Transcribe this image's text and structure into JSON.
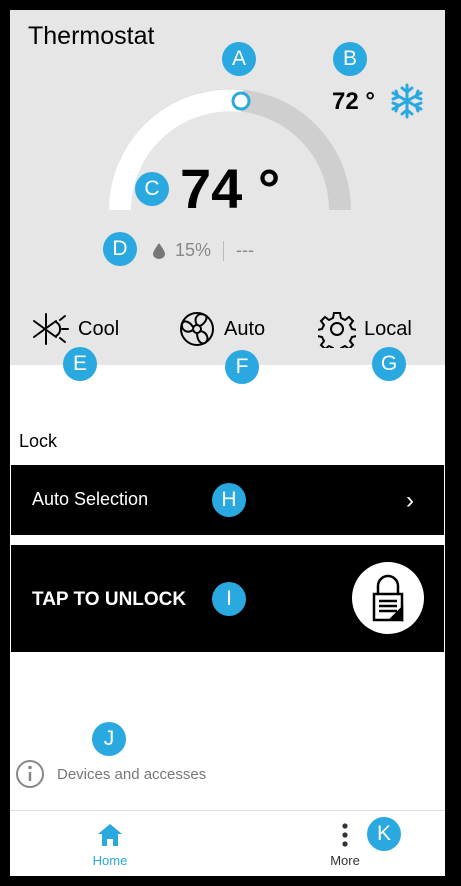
{
  "header": {
    "title": "Thermostat"
  },
  "thermostat": {
    "current_temp": "74 °",
    "setpoint": "72 °",
    "humidity": "15%",
    "secondary_reading": "---",
    "setpoint_level": 0.55
  },
  "modes": {
    "system": "Cool",
    "fan": "Auto",
    "schedule": "Local"
  },
  "lock_section": {
    "label": "Lock",
    "auto_selection": "Auto Selection",
    "unlock_label": "TAP TO UNLOCK"
  },
  "info": {
    "text": "Devices and accesses"
  },
  "bottom_nav": {
    "home": "Home",
    "more": "More"
  },
  "badges": {
    "a": "A",
    "b": "B",
    "c": "C",
    "d": "D",
    "e": "E",
    "f": "F",
    "g": "G",
    "h": "H",
    "i": "I",
    "j": "J",
    "k": "K"
  },
  "colors": {
    "accent": "#2aa8e0",
    "panel": "#e6e6e6",
    "bar": "#000000"
  }
}
